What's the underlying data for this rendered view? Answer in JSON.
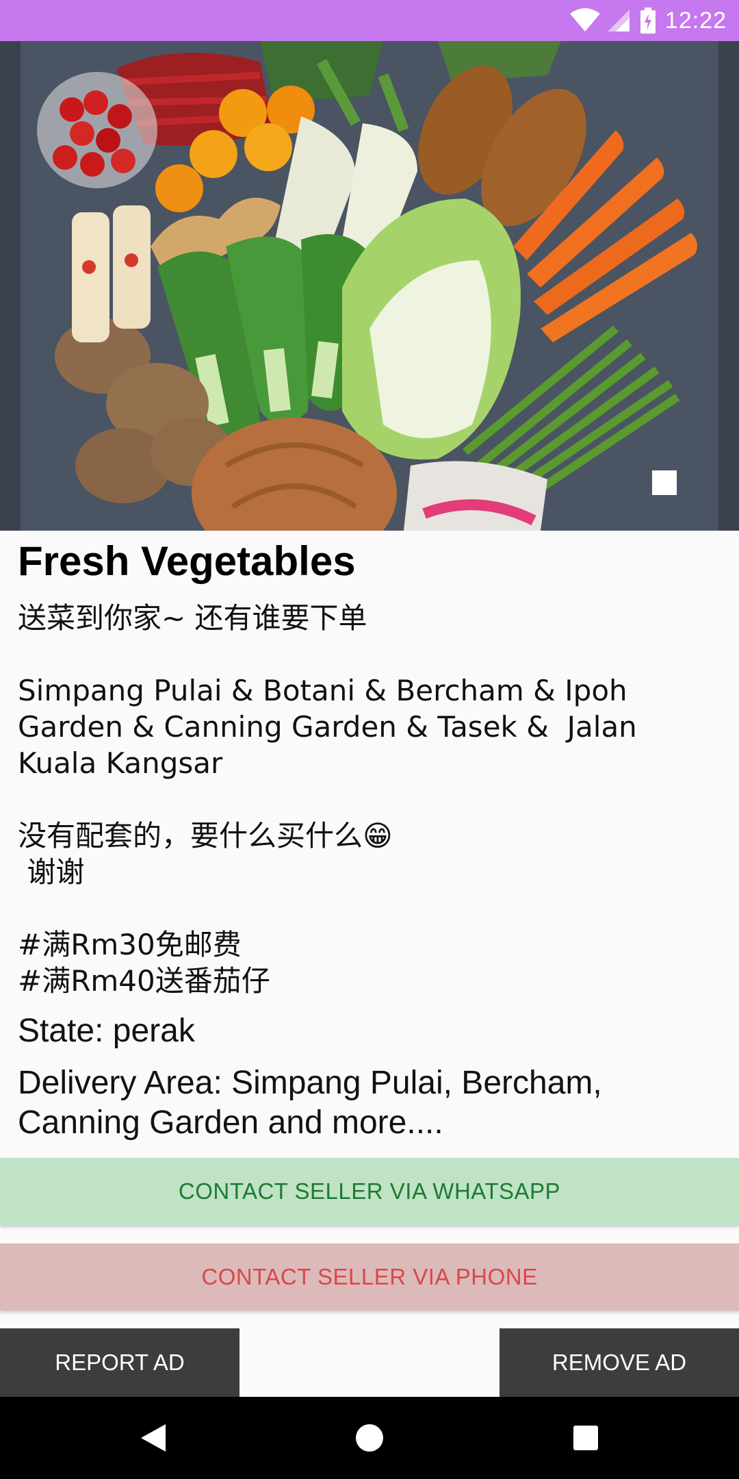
{
  "status_bar": {
    "time": "12:22",
    "background": "#c678ee",
    "icons": [
      "wifi-icon",
      "cellular-signal-icon",
      "battery-charging-icon"
    ]
  },
  "product": {
    "image_description_name": "vegetables-photo",
    "title": "Fresh Vegetables",
    "description": "送菜到你家~ 还有谁要下单\n\nSimpang Pulai & Botani & Bercham & Ipoh Garden & Canning Garden & Tasek &  Jalan Kuala Kangsar\n\n没有配套的，要什么买什么😁\n 谢谢\n\n#满Rm30免邮费\n#满Rm40送番茄仔",
    "state": "State: perak",
    "delivery_area": "Delivery Area: Simpang Pulai, Bercham, Canning Garden and more...."
  },
  "actions": {
    "whatsapp_label": "CONTACT SELLER VIA WHATSAPP",
    "phone_label": "CONTACT SELLER VIA PHONE",
    "report_label": "REPORT AD",
    "remove_label": "REMOVE AD"
  },
  "colors": {
    "whatsapp_bg": "#bfe3c4",
    "whatsapp_text": "#1f7a33",
    "phone_bg": "#dcbab9",
    "phone_text": "#d84848",
    "bottom_action_bg": "#3d3d3d"
  },
  "nav_bar": {
    "icons": [
      "back-icon",
      "home-icon",
      "recents-icon"
    ]
  }
}
